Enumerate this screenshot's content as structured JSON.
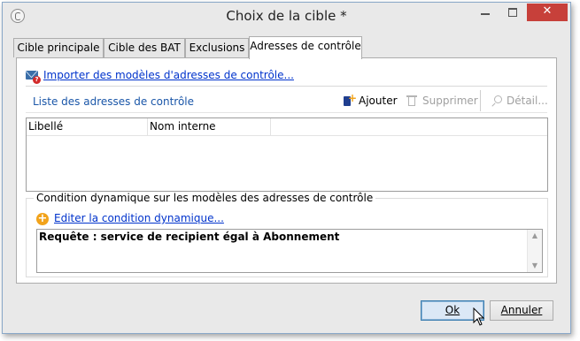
{
  "window": {
    "title": "Choix de la cible *",
    "close_label": "✕"
  },
  "tabs": [
    {
      "label": "Cible principale",
      "active": false
    },
    {
      "label": "Cible des BAT",
      "active": false
    },
    {
      "label": "Exclusions",
      "active": false
    },
    {
      "label": "Adresses de contrôle",
      "active": true
    }
  ],
  "import_link": "Importer des modèles d'adresses de contrôle...",
  "list": {
    "title": "Liste des adresses de contrôle",
    "toolbar": {
      "add": "Ajouter",
      "delete": "Supprimer",
      "detail": "Détail..."
    },
    "columns": [
      "Libellé",
      "Nom interne",
      ""
    ],
    "rows": []
  },
  "condition": {
    "group_title": "Condition dynamique sur les modèles des adresses de contrôle",
    "edit_link": "Editer la condition dynamique...",
    "query": "Requête : service de recipient égal à Abonnement"
  },
  "buttons": {
    "ok": "Ok",
    "cancel": "Annuler"
  }
}
